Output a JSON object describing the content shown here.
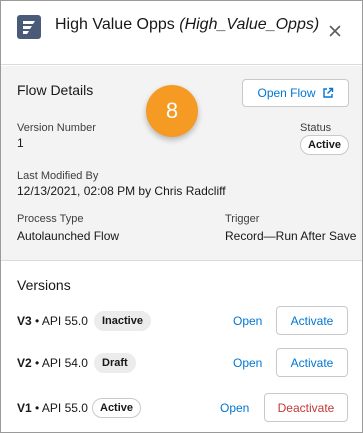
{
  "header": {
    "title": "High Value Opps",
    "api_name": "(High_Value_Opps)",
    "close_icon": "close-icon",
    "app_icon": "flow-icon"
  },
  "details": {
    "section_title": "Flow Details",
    "open_flow_label": "Open Flow",
    "open_flow_icon": "external-link-icon",
    "step_badge": "8",
    "version_number_label": "Version Number",
    "version_number_value": "1",
    "status_label": "Status",
    "status_value": "Active",
    "last_modified_label": "Last Modified By",
    "last_modified_value": "12/13/2021, 02:08 PM by Chris Radcliff",
    "process_type_label": "Process Type",
    "process_type_value": "Autolaunched Flow",
    "trigger_label": "Trigger",
    "trigger_value": "Record—Run After Save"
  },
  "versions": {
    "section_title": "Versions",
    "rows": [
      {
        "version": "V3",
        "api": "• API 55.0",
        "status": "Inactive",
        "open_label": "Open",
        "action_label": "Activate"
      },
      {
        "version": "V2",
        "api": "• API 54.0",
        "status": "Draft",
        "open_label": "Open",
        "action_label": "Activate"
      },
      {
        "version": "V1",
        "api": "• API 55.0",
        "status": "Active",
        "open_label": "Open",
        "action_label": "Deactivate"
      }
    ]
  },
  "colors": {
    "accent": "#0176d3",
    "danger": "#c23934",
    "badge": "#f59a23",
    "icon_bg": "#4a5b7a"
  }
}
